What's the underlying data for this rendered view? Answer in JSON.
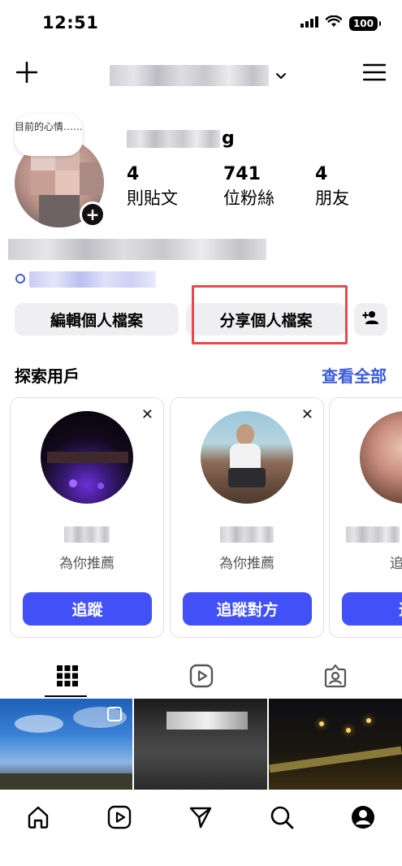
{
  "status_bar": {
    "time": "12:51",
    "battery": "100",
    "icons": [
      "signal-icon",
      "wifi-icon",
      "battery-icon"
    ]
  },
  "top_bar": {
    "icons": [
      "plus-icon",
      "chevron-down-icon",
      "menu-icon"
    ]
  },
  "profile": {
    "note": "目前的心情……",
    "name_suffix": "g",
    "stats": [
      {
        "value": "4",
        "label": "則貼文"
      },
      {
        "value": "741",
        "label": "位粉絲"
      },
      {
        "value": "4",
        "label": "朋友"
      }
    ]
  },
  "actions": {
    "edit_label": "編輯個人檔案",
    "share_label": "分享個人檔案"
  },
  "discover": {
    "title": "探索用戶",
    "see_all": "查看全部",
    "cards": [
      {
        "subtitle": "為你推薦",
        "button": "追蹤"
      },
      {
        "subtitle": "為你推薦",
        "button": "追蹤對方"
      },
      {
        "subtitle": "追",
        "button": "追"
      }
    ]
  },
  "tabs": {
    "icons": [
      "grid-icon",
      "reels-icon",
      "tagged-icon"
    ]
  },
  "bottom_nav": {
    "icons": [
      "home-icon",
      "reels-icon",
      "send-icon",
      "search-icon",
      "profile-icon"
    ]
  },
  "colors": {
    "accent": "#4150f7",
    "link": "#3b5bdb",
    "highlight": "#e8484c"
  }
}
